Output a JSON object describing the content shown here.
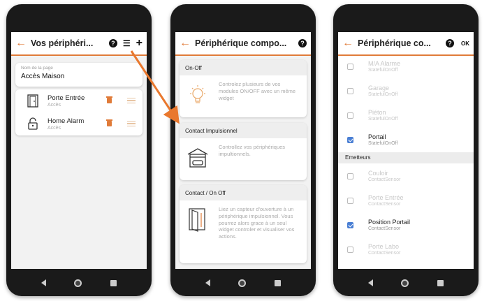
{
  "colors": {
    "accent": "#e07b39",
    "check": "#4a7fd4"
  },
  "screen1": {
    "title": "Vos périphéri...",
    "back_icon": "←",
    "help_icon": "?",
    "list_icon": "☰",
    "add_icon": "+",
    "page_name_label": "Nom de la page",
    "page_name_value": "Accès Maison",
    "devices": [
      {
        "name": "Porte Entrée",
        "sub": "Accès",
        "icon": "door-icon"
      },
      {
        "name": "Home Alarm",
        "sub": "Accès",
        "icon": "padlock-icon"
      }
    ]
  },
  "screen2": {
    "title": "Périphérique compo...",
    "back_icon": "←",
    "help_icon": "?",
    "sections": [
      {
        "header": "On-Off",
        "icon": "lightbulb-icon",
        "desc": "Controlez plusieurs de vos modules ON/OFF avec un même widget"
      },
      {
        "header": "Contact Impulsionnel",
        "icon": "garage-icon",
        "desc": "Controllez vos périphériques impultionnels."
      },
      {
        "header": "Contact / On Off",
        "icon": "door-sensor-icon",
        "desc": "Liez un capteur d'ouverture à un périphérique impulsionnel. Vous pourrez alors grace à un seul widget controler et visualiser vos actions."
      }
    ]
  },
  "screen3": {
    "title": "Périphérique co...",
    "back_icon": "←",
    "help_icon": "?",
    "ok_label": "OK",
    "group_header": "Emetteurs",
    "receivers": [
      {
        "name": "M/A Alarme",
        "sub": "StatefulOnOff",
        "checked": false
      },
      {
        "name": "Garage",
        "sub": "StatefulOnOff",
        "checked": false
      },
      {
        "name": "Piéton",
        "sub": "StatefulOnOff",
        "checked": false
      },
      {
        "name": "Portail",
        "sub": "StatefulOnOff",
        "checked": true
      }
    ],
    "emitters": [
      {
        "name": "Couloir",
        "sub": "ContactSensor",
        "checked": false
      },
      {
        "name": "Porte Entrée",
        "sub": "ContactSensor",
        "checked": false
      },
      {
        "name": "Position Portail",
        "sub": "ContactSensor",
        "checked": true
      },
      {
        "name": "Porte Labo",
        "sub": "ContactSensor",
        "checked": false
      }
    ]
  }
}
